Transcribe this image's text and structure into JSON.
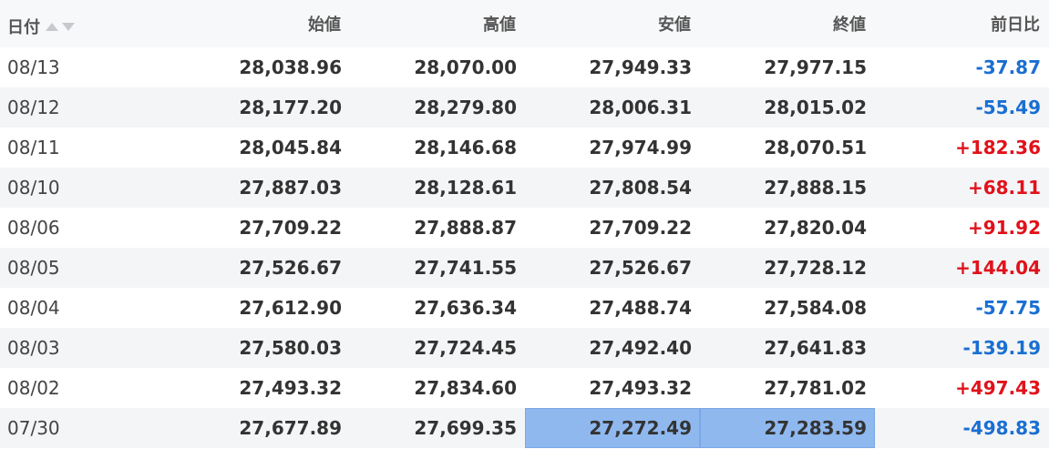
{
  "table": {
    "headers": {
      "date": "日付",
      "open": "始値",
      "high": "高値",
      "low": "安値",
      "close": "終値",
      "change": "前日比"
    },
    "rows": [
      {
        "date": "08/13",
        "open": "28,038.96",
        "high": "28,070.00",
        "low": "27,949.33",
        "close": "27,977.15",
        "change": "-37.87",
        "dir": "neg"
      },
      {
        "date": "08/12",
        "open": "28,177.20",
        "high": "28,279.80",
        "low": "28,006.31",
        "close": "28,015.02",
        "change": "-55.49",
        "dir": "neg"
      },
      {
        "date": "08/11",
        "open": "28,045.84",
        "high": "28,146.68",
        "low": "27,974.99",
        "close": "28,070.51",
        "change": "+182.36",
        "dir": "pos"
      },
      {
        "date": "08/10",
        "open": "27,887.03",
        "high": "28,128.61",
        "low": "27,808.54",
        "close": "27,888.15",
        "change": "+68.11",
        "dir": "pos"
      },
      {
        "date": "08/06",
        "open": "27,709.22",
        "high": "27,888.87",
        "low": "27,709.22",
        "close": "27,820.04",
        "change": "+91.92",
        "dir": "pos"
      },
      {
        "date": "08/05",
        "open": "27,526.67",
        "high": "27,741.55",
        "low": "27,526.67",
        "close": "27,728.12",
        "change": "+144.04",
        "dir": "pos"
      },
      {
        "date": "08/04",
        "open": "27,612.90",
        "high": "27,636.34",
        "low": "27,488.74",
        "close": "27,584.08",
        "change": "-57.75",
        "dir": "neg"
      },
      {
        "date": "08/03",
        "open": "27,580.03",
        "high": "27,724.45",
        "low": "27,492.40",
        "close": "27,641.83",
        "change": "-139.19",
        "dir": "neg"
      },
      {
        "date": "08/02",
        "open": "27,493.32",
        "high": "27,834.60",
        "low": "27,493.32",
        "close": "27,781.02",
        "change": "+497.43",
        "dir": "pos"
      },
      {
        "date": "07/30",
        "open": "27,677.89",
        "high": "27,699.35",
        "low": "27,272.49",
        "close": "27,283.59",
        "change": "-498.83",
        "dir": "neg"
      }
    ]
  },
  "selection": {
    "row": 9,
    "columns": [
      "low",
      "close"
    ]
  },
  "icons": {
    "sort_asc": "sort-ascending-icon",
    "sort_desc": "sort-descending-icon"
  },
  "colors": {
    "negative": "#1a6fd1",
    "positive": "#e0121b",
    "selection": "#8fb8ef",
    "header_bg": "#f7f8fa",
    "stripe_bg": "#f4f5f7"
  }
}
